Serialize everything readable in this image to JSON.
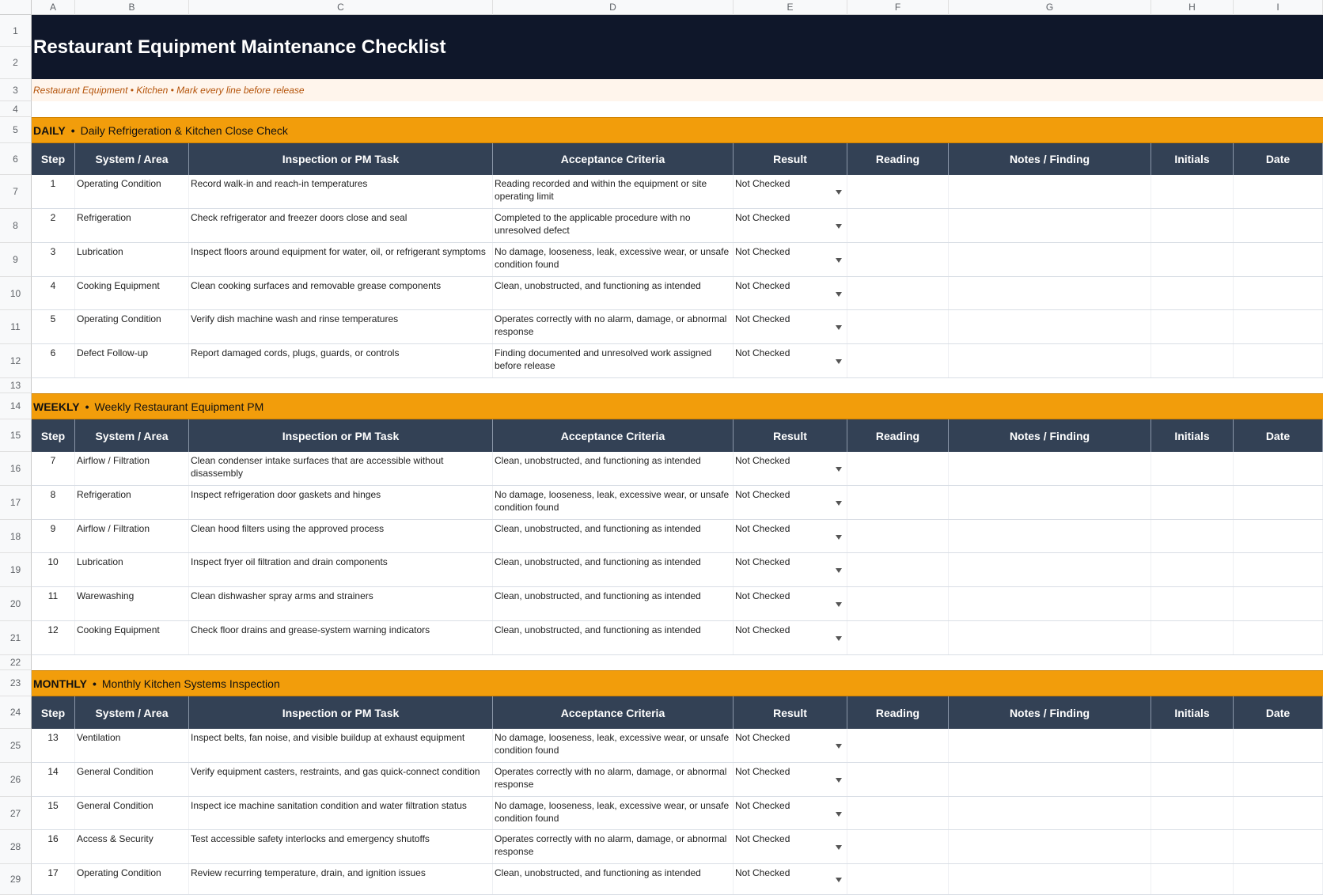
{
  "columns": [
    "A",
    "B",
    "C",
    "D",
    "E",
    "F",
    "G",
    "H",
    "I"
  ],
  "row_numbers": [
    "1",
    "2",
    "3",
    "4",
    "5",
    "6",
    "7",
    "8",
    "9",
    "10",
    "11",
    "12",
    "13",
    "14",
    "15",
    "16",
    "17",
    "18",
    "19",
    "20",
    "21",
    "22",
    "23",
    "24",
    "25",
    "26",
    "27",
    "28",
    "29"
  ],
  "title": "Restaurant Equipment Maintenance Checklist",
  "subtitle": "Restaurant Equipment • Kitchen • Mark every line before release",
  "bullet": "•",
  "headers": [
    "Step",
    "System / Area",
    "Inspection or PM Task",
    "Acceptance Criteria",
    "Result",
    "Reading",
    "Notes / Finding",
    "Initials",
    "Date"
  ],
  "sections": [
    {
      "code": "DAILY",
      "name": "Daily Refrigeration & Kitchen Close Check",
      "rows": [
        {
          "step": "1",
          "system": "Operating Condition",
          "task": "Record walk-in and reach-in temperatures",
          "criteria": "Reading recorded and within the equipment or site operating limit",
          "result": "Not Checked"
        },
        {
          "step": "2",
          "system": "Refrigeration",
          "task": "Check refrigerator and freezer doors close and seal",
          "criteria": "Completed to the applicable procedure with no unresolved defect",
          "result": "Not Checked"
        },
        {
          "step": "3",
          "system": "Lubrication",
          "task": "Inspect floors around equipment for water, oil, or refrigerant symptoms",
          "criteria": "No damage, looseness, leak, excessive wear, or unsafe condition found",
          "result": "Not Checked"
        },
        {
          "step": "4",
          "system": "Cooking Equipment",
          "task": "Clean cooking surfaces and removable grease components",
          "criteria": "Clean, unobstructed, and functioning as intended",
          "result": "Not Checked"
        },
        {
          "step": "5",
          "system": "Operating Condition",
          "task": "Verify dish machine wash and rinse temperatures",
          "criteria": "Operates correctly with no alarm, damage, or abnormal response",
          "result": "Not Checked"
        },
        {
          "step": "6",
          "system": "Defect Follow-up",
          "task": "Report damaged cords, plugs, guards, or controls",
          "criteria": "Finding documented and unresolved work assigned before release",
          "result": "Not Checked"
        }
      ]
    },
    {
      "code": "WEEKLY",
      "name": "Weekly Restaurant Equipment PM",
      "rows": [
        {
          "step": "7",
          "system": "Airflow / Filtration",
          "task": "Clean condenser intake surfaces that are accessible without disassembly",
          "criteria": "Clean, unobstructed, and functioning as intended",
          "result": "Not Checked"
        },
        {
          "step": "8",
          "system": "Refrigeration",
          "task": "Inspect refrigeration door gaskets and hinges",
          "criteria": "No damage, looseness, leak, excessive wear, or unsafe condition found",
          "result": "Not Checked"
        },
        {
          "step": "9",
          "system": "Airflow / Filtration",
          "task": "Clean hood filters using the approved process",
          "criteria": "Clean, unobstructed, and functioning as intended",
          "result": "Not Checked"
        },
        {
          "step": "10",
          "system": "Lubrication",
          "task": "Inspect fryer oil filtration and drain components",
          "criteria": "Clean, unobstructed, and functioning as intended",
          "result": "Not Checked"
        },
        {
          "step": "11",
          "system": "Warewashing",
          "task": "Clean dishwasher spray arms and strainers",
          "criteria": "Clean, unobstructed, and functioning as intended",
          "result": "Not Checked"
        },
        {
          "step": "12",
          "system": "Cooking Equipment",
          "task": "Check floor drains and grease-system warning indicators",
          "criteria": "Clean, unobstructed, and functioning as intended",
          "result": "Not Checked"
        }
      ]
    },
    {
      "code": "MONTHLY",
      "name": "Monthly Kitchen Systems Inspection",
      "rows": [
        {
          "step": "13",
          "system": "Ventilation",
          "task": "Inspect belts, fan noise, and visible buildup at exhaust equipment",
          "criteria": "No damage, looseness, leak, excessive wear, or unsafe condition found",
          "result": "Not Checked"
        },
        {
          "step": "14",
          "system": "General Condition",
          "task": "Verify equipment casters, restraints, and gas quick-connect condition",
          "criteria": "Operates correctly with no alarm, damage, or abnormal response",
          "result": "Not Checked"
        },
        {
          "step": "15",
          "system": "General Condition",
          "task": "Inspect ice machine sanitation condition and water filtration status",
          "criteria": "No damage, looseness, leak, excessive wear, or unsafe condition found",
          "result": "Not Checked"
        },
        {
          "step": "16",
          "system": "Access & Security",
          "task": "Test accessible safety interlocks and emergency shutoffs",
          "criteria": "Operates correctly with no alarm, damage, or abnormal response",
          "result": "Not Checked"
        },
        {
          "step": "17",
          "system": "Operating Condition",
          "task": "Review recurring temperature, drain, and ignition issues",
          "criteria": "Clean, unobstructed, and functioning as intended",
          "result": "Not Checked"
        }
      ]
    }
  ],
  "colors": {
    "title_bg": "#0f172a",
    "subtitle_bg": "#fff5ec",
    "subtitle_text": "#b45309",
    "band_bg": "#f29d0b",
    "header_bg": "#334155"
  }
}
